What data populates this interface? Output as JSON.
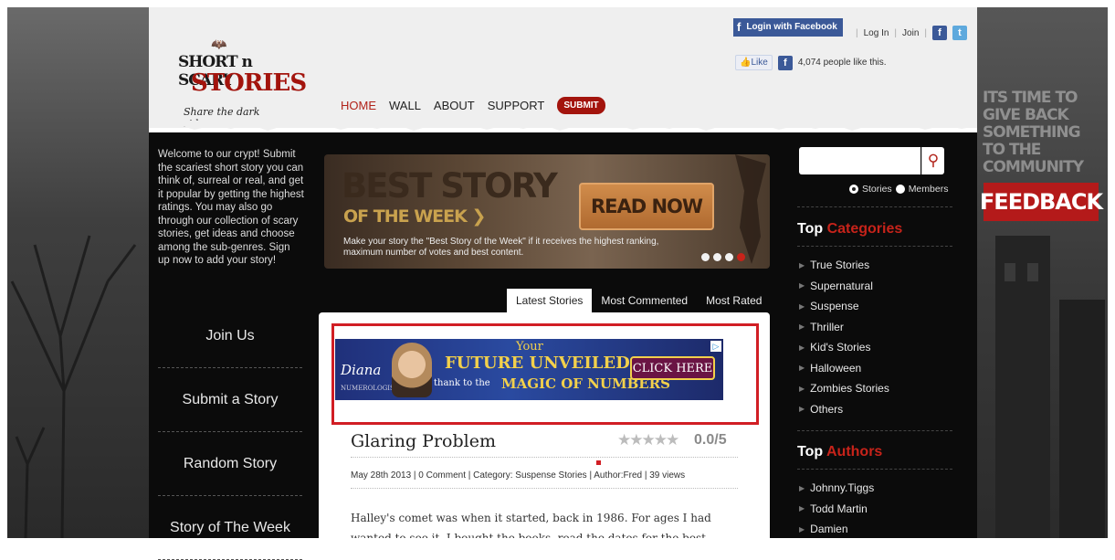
{
  "logo": {
    "line1": "SHORT n SCARY",
    "line2": "STORIES",
    "tagline": "Share the dark side"
  },
  "nav": {
    "home": "HOME",
    "wall": "WALL",
    "about": "ABOUT",
    "support": "SUPPORT",
    "submit": "SUBMIT"
  },
  "auth": {
    "facebook_login": "Login with Facebook",
    "login": "Log In",
    "join": "Join"
  },
  "like": {
    "button": "Like",
    "count_text": "4,074 people like this."
  },
  "intro": "Welcome to our crypt! Submit the scariest short story you can think of, surreal or real, and get it popular by getting the highest ratings. You may also go through our collection of scary stories, get ideas and choose among the sub-genres. Sign up now to add your story!",
  "left_menu": [
    "Join Us",
    "Submit a Story",
    "Random Story",
    "Story of The Week"
  ],
  "banner": {
    "title": "BEST STORY",
    "subtitle": "OF THE WEEK ❯",
    "description": "Make your story the \"Best Story of the Week\" if it receives the highest ranking, maximum number of votes and best content.",
    "cta": "READ NOW",
    "slides": 4,
    "active_slide": 4
  },
  "tabs": [
    "Latest Stories",
    "Most Commented",
    "Most Rated"
  ],
  "ad": {
    "brand": "Diana",
    "brand_sub": "NUMEROLOGIST",
    "line1": "Your",
    "line2": "FUTURE UNVEILED",
    "line3a": "thank to the",
    "line3b": "MAGIC OF NUMBERS",
    "cta": "CLICK HERE"
  },
  "post": {
    "title": "Glaring Problem",
    "stars": "★★★★★",
    "rating": "0.0/5",
    "meta": "May 28th 2013 | 0 Comment | Category: Suspense Stories | Author:Fred | 39 views",
    "excerpt": "Halley's comet was when it started, back in 1986. For ages I had wanted to see it. I bought the books, read the dates for the best sightings, scanned the skies with"
  },
  "search": {
    "placeholder": "",
    "opt_stories": "Stories",
    "opt_members": "Members"
  },
  "categories": {
    "heading_a": "Top ",
    "heading_b": "Categories",
    "items": [
      "True Stories",
      "Supernatural",
      "Suspense",
      "Thriller",
      "Kid's Stories",
      "Halloween",
      "Zombies Stories",
      "Others"
    ]
  },
  "authors": {
    "heading_a": "Top ",
    "heading_b": "Authors",
    "items": [
      "Johnny.Tiggs",
      "Todd Martin",
      "Damien"
    ]
  },
  "promo": {
    "text": "ITS TIME TO GIVE BACK SOMETHING TO THE COMMUNITY",
    "feedback": "FEEDBACK"
  }
}
